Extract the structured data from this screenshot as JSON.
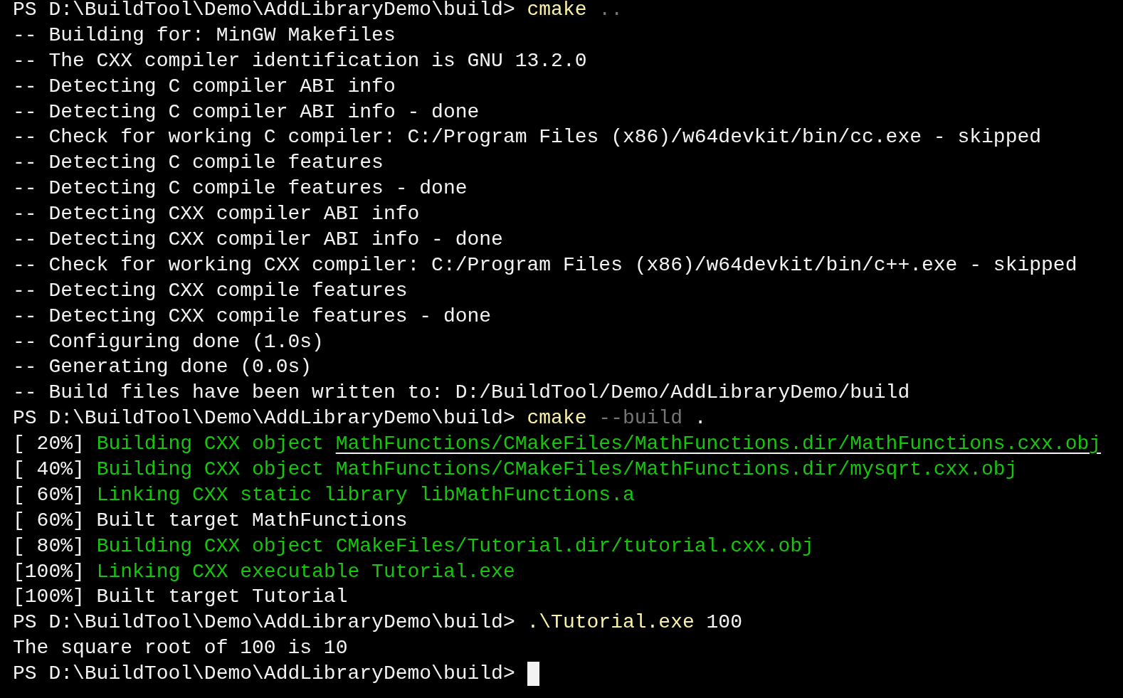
{
  "terminal": {
    "cursor_visible": true,
    "lines": [
      {
        "segments": [
          {
            "kind": "prompt",
            "text": "PS D:\\BuildTool\\Demo\\AddLibraryDemo\\build>"
          },
          {
            "kind": "command",
            "text": "cmake"
          },
          {
            "kind": "argument",
            "text": ".."
          }
        ]
      },
      {
        "segments": [
          {
            "kind": "plain",
            "text": "-- Building for: MinGW Makefiles"
          }
        ]
      },
      {
        "segments": [
          {
            "kind": "plain",
            "text": "-- The CXX compiler identification is GNU 13.2.0"
          }
        ]
      },
      {
        "segments": [
          {
            "kind": "plain",
            "text": "-- Detecting C compiler ABI info"
          }
        ]
      },
      {
        "segments": [
          {
            "kind": "plain",
            "text": "-- Detecting C compiler ABI info - done"
          }
        ]
      },
      {
        "segments": [
          {
            "kind": "plain",
            "text": "-- Check for working C compiler: C:/Program Files (x86)/w64devkit/bin/cc.exe - skipped"
          }
        ]
      },
      {
        "segments": [
          {
            "kind": "plain",
            "text": "-- Detecting C compile features"
          }
        ]
      },
      {
        "segments": [
          {
            "kind": "plain",
            "text": "-- Detecting C compile features - done"
          }
        ]
      },
      {
        "segments": [
          {
            "kind": "plain",
            "text": "-- Detecting CXX compiler ABI info"
          }
        ]
      },
      {
        "segments": [
          {
            "kind": "plain",
            "text": "-- Detecting CXX compiler ABI info - done"
          }
        ]
      },
      {
        "segments": [
          {
            "kind": "plain",
            "text": "-- Check for working CXX compiler: C:/Program Files (x86)/w64devkit/bin/c++.exe - skipped"
          }
        ]
      },
      {
        "segments": [
          {
            "kind": "plain",
            "text": "-- Detecting CXX compile features"
          }
        ]
      },
      {
        "segments": [
          {
            "kind": "plain",
            "text": "-- Detecting CXX compile features - done"
          }
        ]
      },
      {
        "segments": [
          {
            "kind": "plain",
            "text": "-- Configuring done (1.0s)"
          }
        ]
      },
      {
        "segments": [
          {
            "kind": "plain",
            "text": "-- Generating done (0.0s)"
          }
        ]
      },
      {
        "segments": [
          {
            "kind": "plain",
            "text": "-- Build files have been written to: D:/BuildTool/Demo/AddLibraryDemo/build"
          }
        ]
      },
      {
        "segments": [
          {
            "kind": "prompt",
            "text": "PS D:\\BuildTool\\Demo\\AddLibraryDemo\\build>"
          },
          {
            "kind": "command",
            "text": "cmake"
          },
          {
            "kind": "argument",
            "text": "--build"
          },
          {
            "kind": "plain",
            "text": "."
          }
        ]
      },
      {
        "segments": [
          {
            "kind": "plain",
            "text": "[ 20%]"
          },
          {
            "kind": "success",
            "text": "Building CXX object"
          },
          {
            "kind": "link",
            "text": "MathFunctions/CMakeFiles/MathFunctions.dir/MathFunctions.cxx.obj"
          }
        ]
      },
      {
        "segments": [
          {
            "kind": "plain",
            "text": "[ 40%]"
          },
          {
            "kind": "success",
            "text": "Building CXX object MathFunctions/CMakeFiles/MathFunctions.dir/mysqrt.cxx.obj"
          }
        ]
      },
      {
        "segments": [
          {
            "kind": "plain",
            "text": "[ 60%]"
          },
          {
            "kind": "success",
            "text": "Linking CXX static library libMathFunctions.a"
          }
        ]
      },
      {
        "segments": [
          {
            "kind": "plain",
            "text": "[ 60%] Built target MathFunctions"
          }
        ]
      },
      {
        "segments": [
          {
            "kind": "plain",
            "text": "[ 80%]"
          },
          {
            "kind": "success",
            "text": "Building CXX object CMakeFiles/Tutorial.dir/tutorial.cxx.obj"
          }
        ]
      },
      {
        "segments": [
          {
            "kind": "plain",
            "text": "[100%]"
          },
          {
            "kind": "success",
            "text": "Linking CXX executable Tutorial.exe"
          }
        ]
      },
      {
        "segments": [
          {
            "kind": "plain",
            "text": "[100%] Built target Tutorial"
          }
        ]
      },
      {
        "segments": [
          {
            "kind": "prompt",
            "text": "PS D:\\BuildTool\\Demo\\AddLibraryDemo\\build>"
          },
          {
            "kind": "command",
            "text": ".\\Tutorial.exe"
          },
          {
            "kind": "plain",
            "text": "100"
          }
        ]
      },
      {
        "segments": [
          {
            "kind": "plain",
            "text": "The square root of 100 is 10"
          }
        ]
      },
      {
        "segments": [
          {
            "kind": "prompt",
            "text": "PS D:\\BuildTool\\Demo\\AddLibraryDemo\\build>"
          }
        ]
      }
    ]
  }
}
